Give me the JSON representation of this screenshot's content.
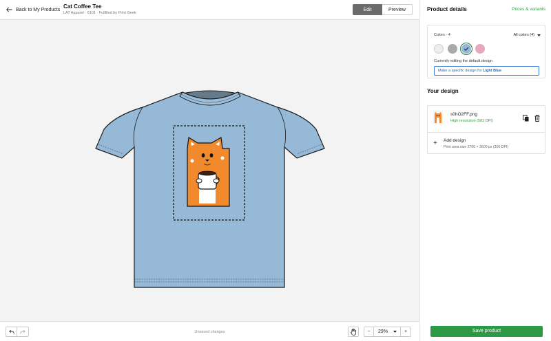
{
  "header": {
    "back_label": "Back to My Products",
    "product_title": "Cat Coffee Tee",
    "product_subtitle": "LAT Apparel · 6101 · Fulfilled by Print Geek",
    "edit_label": "Edit",
    "preview_label": "Preview"
  },
  "footer": {
    "unsaved_label": "Unsaved changes",
    "zoom_value": "29%",
    "zoom_minus": "−",
    "zoom_plus": "+"
  },
  "panel": {
    "title": "Product details",
    "link_label": "Prices & variants",
    "colors_count": "Colors · 4",
    "all_colors_label": "All colors (4)",
    "swatches": [
      {
        "name": "White",
        "hex": "#ededed"
      },
      {
        "name": "Gray",
        "hex": "#a9a9a9"
      },
      {
        "name": "Light Blue",
        "hex": "#95b9d6",
        "selected": true
      },
      {
        "name": "Pink",
        "hex": "#e7a9bd"
      }
    ],
    "editing_note": "Currently editing the default design",
    "specific_prefix": "Make a specific design for ",
    "specific_color": "Light Blue",
    "your_design_title": "Your design",
    "design_file": "s0hO2FF.png",
    "resolution": "High resolution (581 DPI)",
    "add_design_label": "Add design",
    "print_area_label": "Print area size 2700 × 3600 px (300 DPI)",
    "save_label": "Save product"
  },
  "colors": {
    "accent_green": "#2c9a45",
    "shirt_color": "#95b9d6",
    "link_blue": "#3a7bd5"
  }
}
